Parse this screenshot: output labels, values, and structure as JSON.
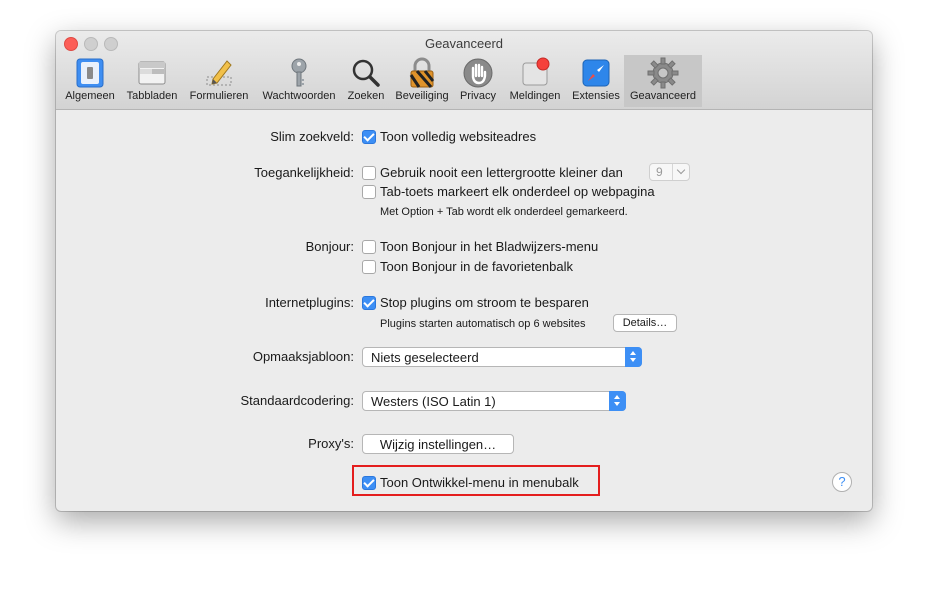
{
  "window": {
    "title": "Geavanceerd"
  },
  "toolbar": {
    "tabs": [
      {
        "label": "Algemeen",
        "icon": "general-switch-icon"
      },
      {
        "label": "Tabbladen",
        "icon": "tabs-icon"
      },
      {
        "label": "Formulieren",
        "icon": "pencil-form-icon"
      },
      {
        "label": "Wachtwoorden",
        "icon": "key-icon"
      },
      {
        "label": "Zoeken",
        "icon": "magnifier-icon"
      },
      {
        "label": "Beveiliging",
        "icon": "lock-icon"
      },
      {
        "label": "Privacy",
        "icon": "hand-icon"
      },
      {
        "label": "Meldingen",
        "icon": "notification-icon"
      },
      {
        "label": "Extensies",
        "icon": "compass-icon"
      },
      {
        "label": "Geavanceerd",
        "icon": "gear-icon",
        "selected": true
      }
    ]
  },
  "settings": {
    "smart_search": {
      "label": "Slim zoekveld:",
      "show_full_address": {
        "label": "Toon volledig websiteadres",
        "checked": true
      }
    },
    "accessibility": {
      "label": "Toegankelijkheid:",
      "min_font": {
        "label": "Gebruik nooit een lettergrootte kleiner dan",
        "checked": false,
        "size_value": "9"
      },
      "tab_key": {
        "label": "Tab-toets markeert elk onderdeel op webpagina",
        "checked": false
      },
      "hint": "Met Option + Tab wordt elk onderdeel gemarkeerd."
    },
    "bonjour": {
      "label": "Bonjour:",
      "bookmarks_menu": {
        "label": "Toon Bonjour in het Bladwijzers-menu",
        "checked": false
      },
      "favorites_bar": {
        "label": "Toon Bonjour in de favorietenbalk",
        "checked": false
      }
    },
    "plugins": {
      "label": "Internetplugins:",
      "stop_plugins": {
        "label": "Stop plugins om stroom te besparen",
        "checked": true
      },
      "note": "Plugins starten automatisch op 6 websites",
      "details_button": "Details…"
    },
    "style_sheet": {
      "label": "Opmaaksjabloon:",
      "value": "Niets geselecteerd"
    },
    "encoding": {
      "label": "Standaardcodering:",
      "value": "Westers (ISO Latin 1)"
    },
    "proxies": {
      "label": "Proxy's:",
      "button": "Wijzig instellingen…"
    },
    "develop_menu": {
      "label": "Toon Ontwikkel-menu in menubalk",
      "checked": true
    }
  },
  "help": {
    "symbol": "?"
  },
  "colors": {
    "accent": "#3d8ff5",
    "highlight_border": "#e41e1e",
    "close_button": "#fc5e57"
  }
}
